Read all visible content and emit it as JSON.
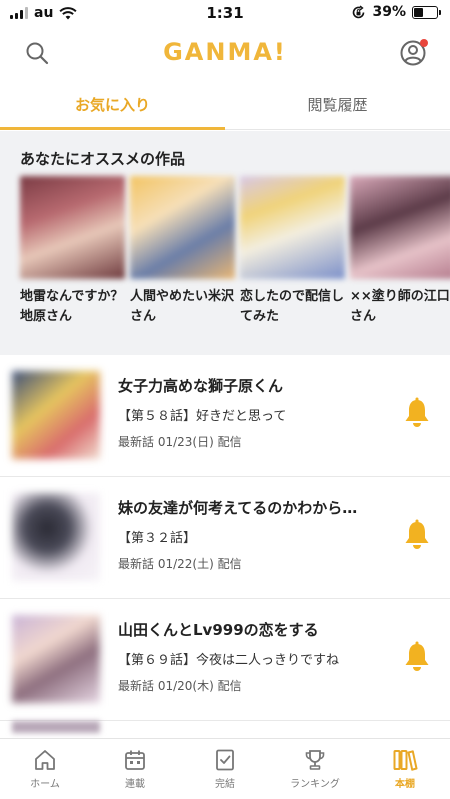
{
  "status_bar": {
    "carrier": "au",
    "time": "1:31",
    "battery": "39%",
    "battery_level": 0.39
  },
  "header": {
    "logo": "GANMA!",
    "search_icon": "search-icon",
    "profile_icon": "profile-icon"
  },
  "tabs": [
    {
      "label": "お気に入り",
      "active": true
    },
    {
      "label": "閲覧履歴",
      "active": false
    }
  ],
  "recommend": {
    "title": "あなたにオススメの作品",
    "items": [
      {
        "label": "地雷なんですか？地原さん"
      },
      {
        "label": "人間やめたい米沢さん"
      },
      {
        "label": "恋したので配信してみた"
      },
      {
        "label": "××塗り師の江口さん"
      }
    ]
  },
  "series": [
    {
      "title": "女子力高めな獅子原くん",
      "episode": "【第５８話】好きだと思って",
      "date": "最新話 01/23(日) 配信"
    },
    {
      "title": "妹の友達が何考えてるのかわから…",
      "episode": "【第３２話】",
      "date": "最新話 01/22(土) 配信"
    },
    {
      "title": "山田くんとLv999の恋をする",
      "episode": "【第６９話】今夜は二人っきりですね",
      "date": "最新話 01/20(木) 配信"
    }
  ],
  "bottom_nav": [
    {
      "label": "ホーム",
      "icon": "home-icon",
      "active": false
    },
    {
      "label": "連載",
      "icon": "calendar-icon",
      "active": false
    },
    {
      "label": "完結",
      "icon": "book-check-icon",
      "active": false
    },
    {
      "label": "ランキング",
      "icon": "trophy-icon",
      "active": false
    },
    {
      "label": "本棚",
      "icon": "bookshelf-icon",
      "active": true
    }
  ],
  "colors": {
    "accent": "#f0b63a",
    "bell": "#f2b221",
    "background_gray": "#f1f2f4"
  }
}
